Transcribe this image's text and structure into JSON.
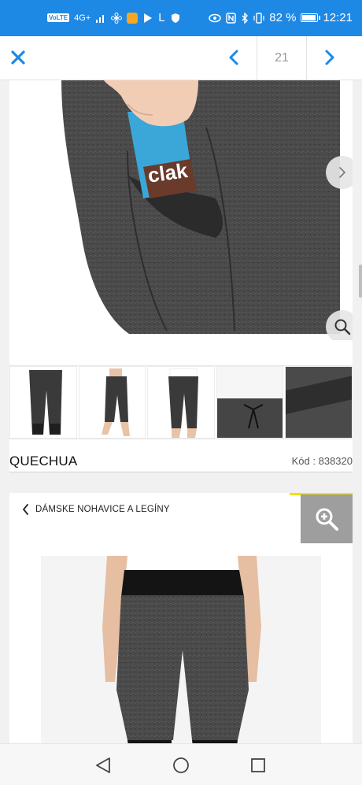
{
  "status_bar": {
    "volte_label": "VoLTE",
    "network_label": "4G+",
    "l_label": "L",
    "battery_text": "82 %",
    "battery_level": 0.82,
    "time": "12:21"
  },
  "toolbar": {
    "close_icon": "close-icon",
    "prev_icon": "chevron-left-icon",
    "page_number": "21",
    "next_icon": "chevron-right-icon"
  },
  "product": {
    "brand": "QUECHUA",
    "code_text": "Kód : 838320",
    "thumbnail_count": 5
  },
  "listing": {
    "breadcrumb_label": "DÁMSKE NOHAVICE A LEGÍNY",
    "zoom_icon": "zoom-in-icon"
  },
  "colors": {
    "status_bar": "#1e88e5",
    "accent": "#1e88e5",
    "fabric": "#4a4a4a",
    "zoom_box": "#9e9e9e",
    "yellow_strip": "#f2e000"
  }
}
